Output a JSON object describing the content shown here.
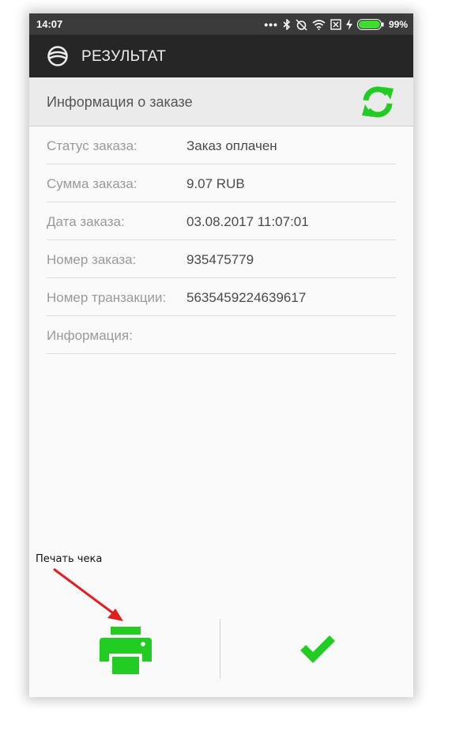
{
  "status_bar": {
    "time": "14:07",
    "battery_percent": "99%"
  },
  "app_bar": {
    "title": "РЕЗУЛЬТАТ"
  },
  "section": {
    "title": "Информация о заказе"
  },
  "order_info": [
    {
      "label": "Статус заказа:",
      "value": "Заказ оплачен"
    },
    {
      "label": "Сумма заказа:",
      "value": "9.07 RUB"
    },
    {
      "label": "Дата заказа:",
      "value": "03.08.2017 11:07:01"
    },
    {
      "label": "Номер заказа:",
      "value": "935475779"
    },
    {
      "label": "Номер транзакции:",
      "value": "5635459224639617"
    },
    {
      "label": "Информация:",
      "value": ""
    }
  ],
  "annotation": {
    "text": "Печать чека"
  },
  "colors": {
    "accent_green": "#22cc22",
    "annotation_arrow": "#e02020",
    "app_bar_bg": "#262626",
    "status_bar_bg": "#3b3b3b"
  },
  "icons": {
    "logo": "app-logo-icon",
    "refresh": "refresh-icon",
    "print": "printer-icon",
    "confirm": "checkmark-icon"
  }
}
